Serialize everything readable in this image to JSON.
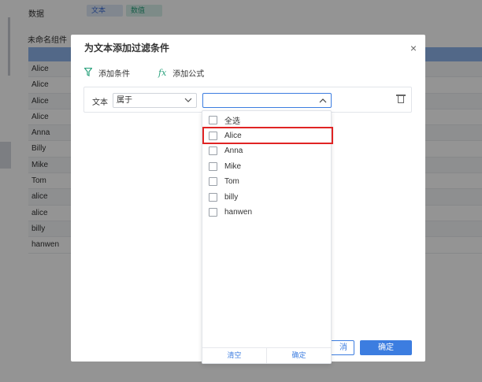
{
  "background": {
    "data_label": "数据",
    "chip_text": "文本",
    "chip_number": "数值",
    "component_title": "未命名组件",
    "rows": [
      "Alice",
      "Alice",
      "Alice",
      "Alice",
      "Anna",
      "Billy",
      "Mike",
      "Tom",
      "alice",
      "alice",
      "billy",
      "hanwen"
    ]
  },
  "dialog": {
    "title": "为文本添加过滤条件",
    "close": "×",
    "add_condition": "添加条件",
    "add_formula": "添加公式",
    "field_label": "文本",
    "operator": "属于",
    "cancel_label": "消",
    "ok_label": "确定"
  },
  "dropdown": {
    "options": [
      "全选",
      "Alice",
      "Anna",
      "Mike",
      "Tom",
      "billy",
      "hanwen"
    ],
    "clear_label": "清空",
    "confirm_label": "确定"
  }
}
